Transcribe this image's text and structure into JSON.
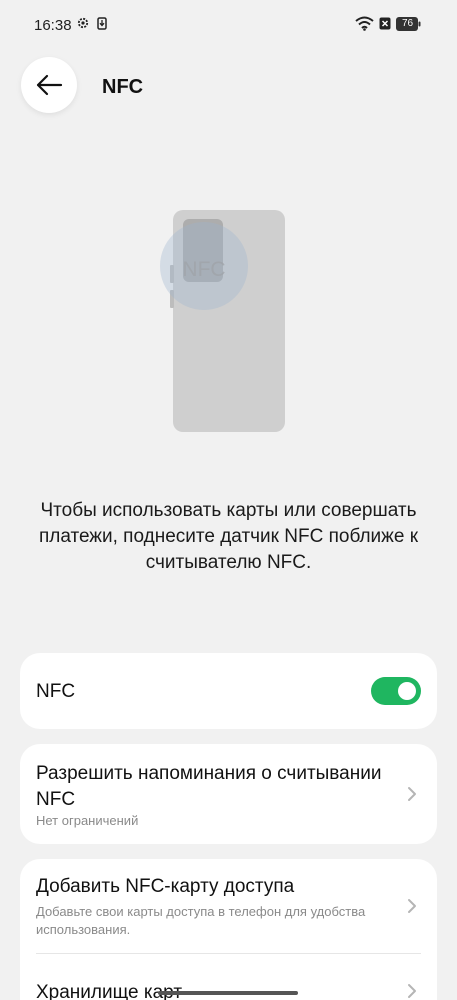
{
  "status_bar": {
    "time": "16:38",
    "battery": "76",
    "icons": [
      "gear-icon",
      "download-icon",
      "wifi-icon",
      "sim-off-icon",
      "battery-icon"
    ]
  },
  "header": {
    "title": "NFC",
    "back_icon": "arrow-left-icon"
  },
  "illustration": {
    "badge_text": "NFC"
  },
  "hint": {
    "text": "Чтобы использовать карты или совершать платежи, поднесите датчик NFC поближе к считывателю NFC."
  },
  "nfc_toggle": {
    "label": "NFC",
    "enabled": true,
    "on_color": "#1fb660"
  },
  "reminder": {
    "title": "Разрешить напоминания о считывании NFC",
    "subtitle": "Нет ограничений"
  },
  "access_card": {
    "title": "Добавить NFC-карту доступа",
    "subtitle": "Добавьте свои карты доступа в телефон для удобства использования."
  },
  "wallet": {
    "title": "Хранилище карт"
  }
}
